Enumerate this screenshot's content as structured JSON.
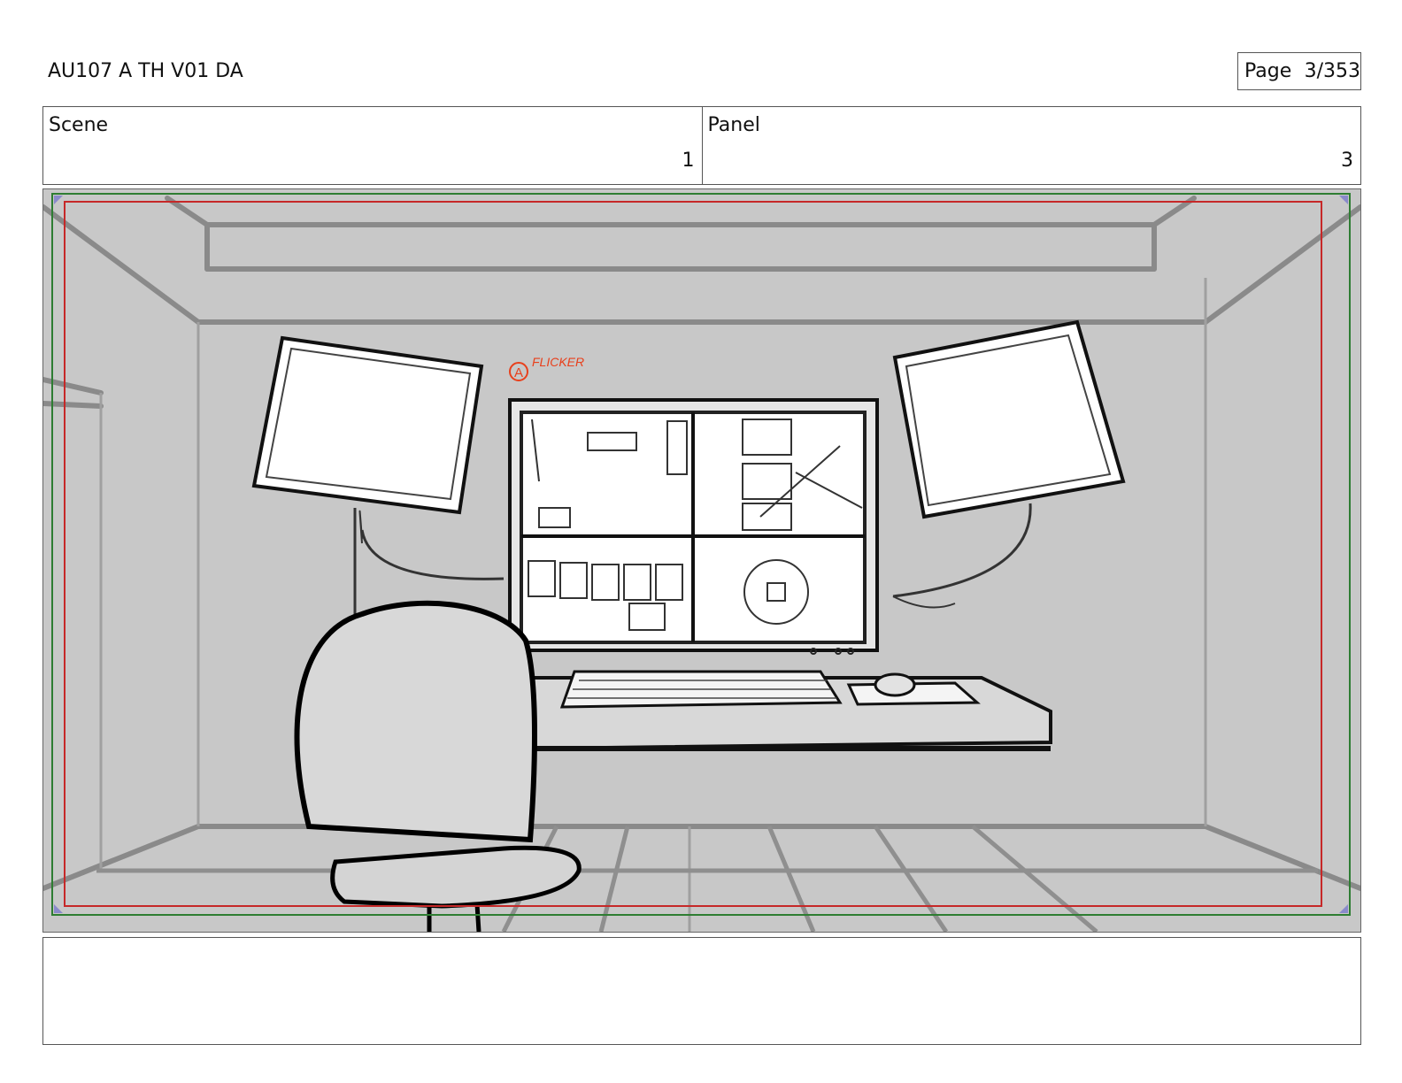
{
  "header": {
    "title": "AU107 A TH V01 DA",
    "page_label": "Page",
    "page_number": "3/353"
  },
  "info": {
    "scene_label": "Scene",
    "scene_value": "1",
    "panel_label": "Panel",
    "panel_value": "3"
  },
  "panel": {
    "annotation_marker": "A",
    "annotation_text": "FLICKER",
    "annotation_color": "#e8401c",
    "safe_frame_colors": {
      "outer": "#2e7d32",
      "inner": "#c62828"
    }
  },
  "notes": {
    "text": ""
  }
}
